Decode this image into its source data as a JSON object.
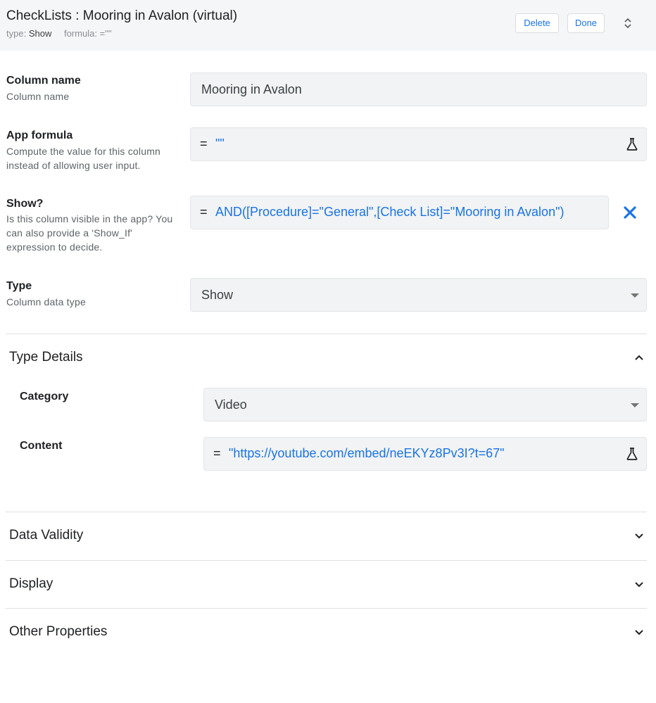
{
  "header": {
    "title": "CheckLists : Mooring in Avalon (virtual)",
    "type_label": "type:",
    "type_value": "Show",
    "formula_label": "formula:",
    "formula_value": "=\"\"",
    "delete_label": "Delete",
    "done_label": "Done",
    "expand_icon": "unfold-icon"
  },
  "fields": {
    "column_name": {
      "label": "Column name",
      "description": "Column name",
      "value": "Mooring in Avalon"
    },
    "app_formula": {
      "label": "App formula",
      "description": "Compute the value for this column instead of allowing user input.",
      "eq": "=",
      "value": "\"\"",
      "icon": "flask-icon"
    },
    "show": {
      "label": "Show?",
      "description": "Is this column visible in the app? You can also provide a 'Show_If' expression to decide.",
      "eq": "=",
      "value": "AND([Procedure]=\"General\",[Check List]=\"Mooring in Avalon\")",
      "clear_icon": "close-icon"
    },
    "type": {
      "label": "Type",
      "description": "Column data type",
      "value": "Show"
    }
  },
  "type_details": {
    "title": "Type Details",
    "expanded": true,
    "category": {
      "label": "Category",
      "value": "Video"
    },
    "content": {
      "label": "Content",
      "eq": "=",
      "value": "\"https://youtube.com/embed/neEKYz8Pv3I?t=67\"",
      "icon": "flask-icon"
    }
  },
  "sections": [
    {
      "title": "Data Validity",
      "expanded": false
    },
    {
      "title": "Display",
      "expanded": false
    },
    {
      "title": "Other Properties",
      "expanded": false
    }
  ],
  "colors": {
    "accent": "#1a73e8",
    "header_bg": "#f5f6f7",
    "field_bg": "#f1f3f4"
  }
}
